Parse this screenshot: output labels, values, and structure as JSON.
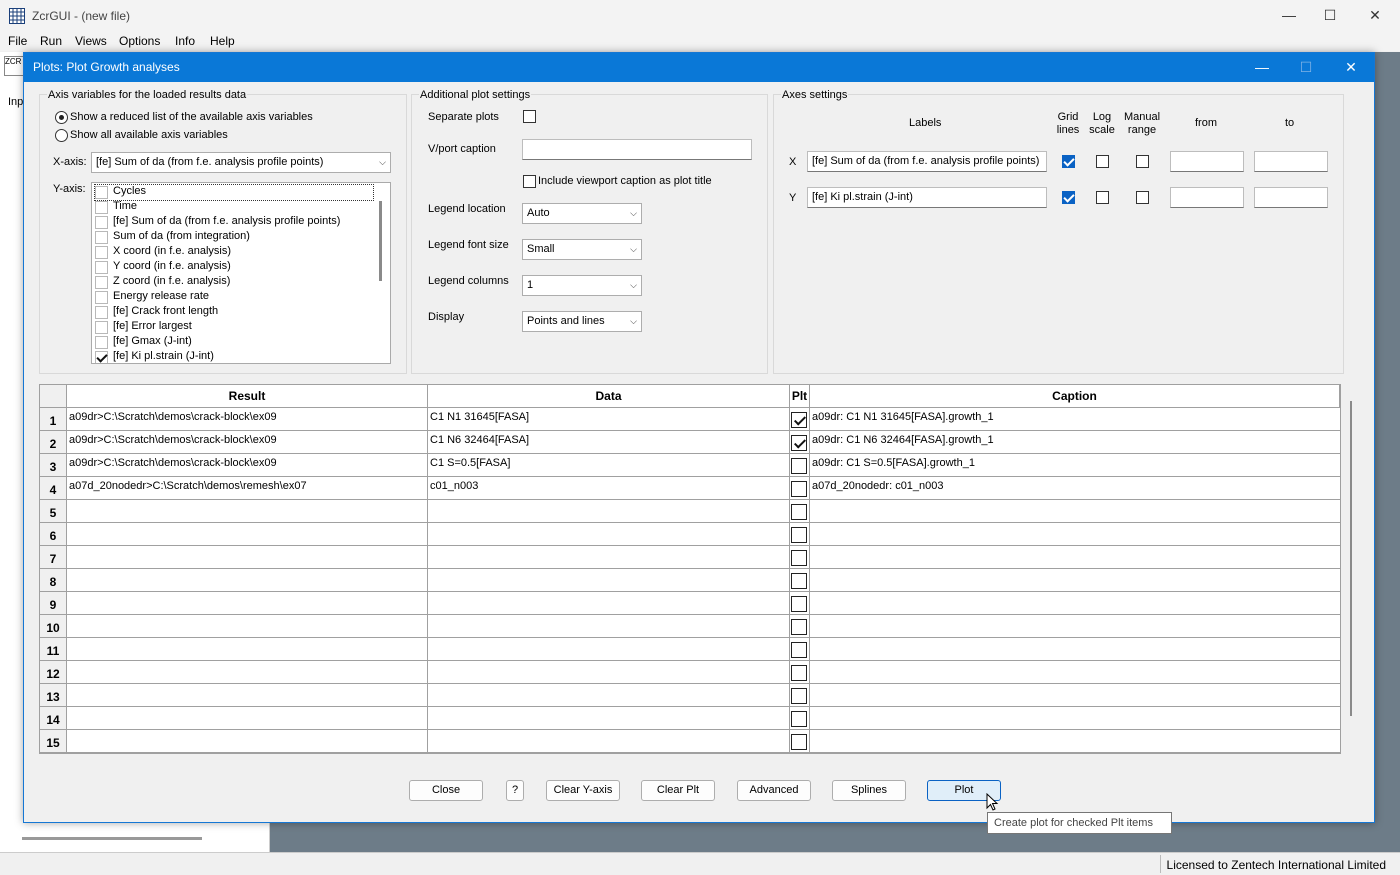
{
  "app": {
    "title": "ZcrGUI - (new file)",
    "menu": [
      "File",
      "Run",
      "Views",
      "Options",
      "Info",
      "Help"
    ],
    "status": "Licensed to Zentech International Limited",
    "left_fragment": "Inp",
    "toolbar_fragment": "ZCR"
  },
  "dialog": {
    "title": "Plots: Plot Growth analyses",
    "axis_vars": {
      "legend": "Axis variables for the loaded results data",
      "radio_reduced": "Show a reduced list of the available axis variables",
      "radio_all": "Show all available axis variables",
      "xaxis_label": "X-axis:",
      "xaxis_value": "[fe] Sum of da (from f.e. analysis profile points)",
      "yaxis_label": "Y-axis:",
      "yaxis_items": [
        {
          "label": "Cycles",
          "checked": false
        },
        {
          "label": "Time",
          "checked": false
        },
        {
          "label": "[fe] Sum of da (from f.e. analysis profile points)",
          "checked": false
        },
        {
          "label": "Sum of da (from integration)",
          "checked": false
        },
        {
          "label": "X coord (in f.e. analysis)",
          "checked": false
        },
        {
          "label": "Y coord (in f.e. analysis)",
          "checked": false
        },
        {
          "label": "Z coord (in f.e. analysis)",
          "checked": false
        },
        {
          "label": "Energy release rate",
          "checked": false
        },
        {
          "label": "[fe] Crack front length",
          "checked": false
        },
        {
          "label": "[fe] Error largest",
          "checked": false
        },
        {
          "label": "[fe] Gmax (J-int)",
          "checked": false
        },
        {
          "label": "[fe] Ki pl.strain (J-int)",
          "checked": true
        }
      ]
    },
    "additional": {
      "legend": "Additional plot settings",
      "separate_plots": "Separate plots",
      "vport_caption": "V/port caption",
      "include_caption": "Include viewport caption as plot title",
      "legend_location_label": "Legend location",
      "legend_location_value": "Auto",
      "legend_font_label": "Legend font size",
      "legend_font_value": "Small",
      "legend_columns_label": "Legend columns",
      "legend_columns_value": "1",
      "display_label": "Display",
      "display_value": "Points and lines"
    },
    "axes": {
      "legend": "Axes settings",
      "col_labels": "Labels",
      "col_grid": "Grid lines",
      "col_log": "Log scale",
      "col_manual": "Manual range",
      "col_from": "from",
      "col_to": "to",
      "x_name": "X",
      "x_label": "[fe] Sum of da (from f.e. analysis profile points)",
      "x_grid": true,
      "y_name": "Y",
      "y_label": "[fe] Ki pl.strain (J-int)",
      "y_grid": true
    },
    "grid": {
      "headers": [
        "Result",
        "Data",
        "Plt",
        "Caption"
      ],
      "rows": [
        {
          "n": "1",
          "result": "a09dr>C:\\Scratch\\demos\\crack-block\\ex09",
          "data": "C1 N1 31645[FASA]",
          "plt": true,
          "caption": "a09dr: C1 N1 31645[FASA].growth_1"
        },
        {
          "n": "2",
          "result": "a09dr>C:\\Scratch\\demos\\crack-block\\ex09",
          "data": "C1 N6 32464[FASA]",
          "plt": true,
          "caption": "a09dr: C1 N6 32464[FASA].growth_1"
        },
        {
          "n": "3",
          "result": "a09dr>C:\\Scratch\\demos\\crack-block\\ex09",
          "data": "C1 S=0.5[FASA]",
          "plt": false,
          "caption": "a09dr: C1 S=0.5[FASA].growth_1"
        },
        {
          "n": "4",
          "result": "a07d_20nodedr>C:\\Scratch\\demos\\remesh\\ex07",
          "data": "c01_n003",
          "plt": false,
          "caption": "a07d_20nodedr: c01_n003"
        },
        {
          "n": "5",
          "result": "",
          "data": "",
          "plt": false,
          "caption": ""
        },
        {
          "n": "6",
          "result": "",
          "data": "",
          "plt": false,
          "caption": ""
        },
        {
          "n": "7",
          "result": "",
          "data": "",
          "plt": false,
          "caption": ""
        },
        {
          "n": "8",
          "result": "",
          "data": "",
          "plt": false,
          "caption": ""
        },
        {
          "n": "9",
          "result": "",
          "data": "",
          "plt": false,
          "caption": ""
        },
        {
          "n": "10",
          "result": "",
          "data": "",
          "plt": false,
          "caption": ""
        },
        {
          "n": "11",
          "result": "",
          "data": "",
          "plt": false,
          "caption": ""
        },
        {
          "n": "12",
          "result": "",
          "data": "",
          "plt": false,
          "caption": ""
        },
        {
          "n": "13",
          "result": "",
          "data": "",
          "plt": false,
          "caption": ""
        },
        {
          "n": "14",
          "result": "",
          "data": "",
          "plt": false,
          "caption": ""
        },
        {
          "n": "15",
          "result": "",
          "data": "",
          "plt": false,
          "caption": ""
        }
      ]
    },
    "buttons": {
      "close": "Close",
      "help": "?",
      "clear_yaxis": "Clear Y-axis",
      "clear_plt": "Clear Plt",
      "advanced": "Advanced",
      "splines": "Splines",
      "plot": "Plot"
    },
    "tooltip": "Create plot for checked Plt items"
  }
}
